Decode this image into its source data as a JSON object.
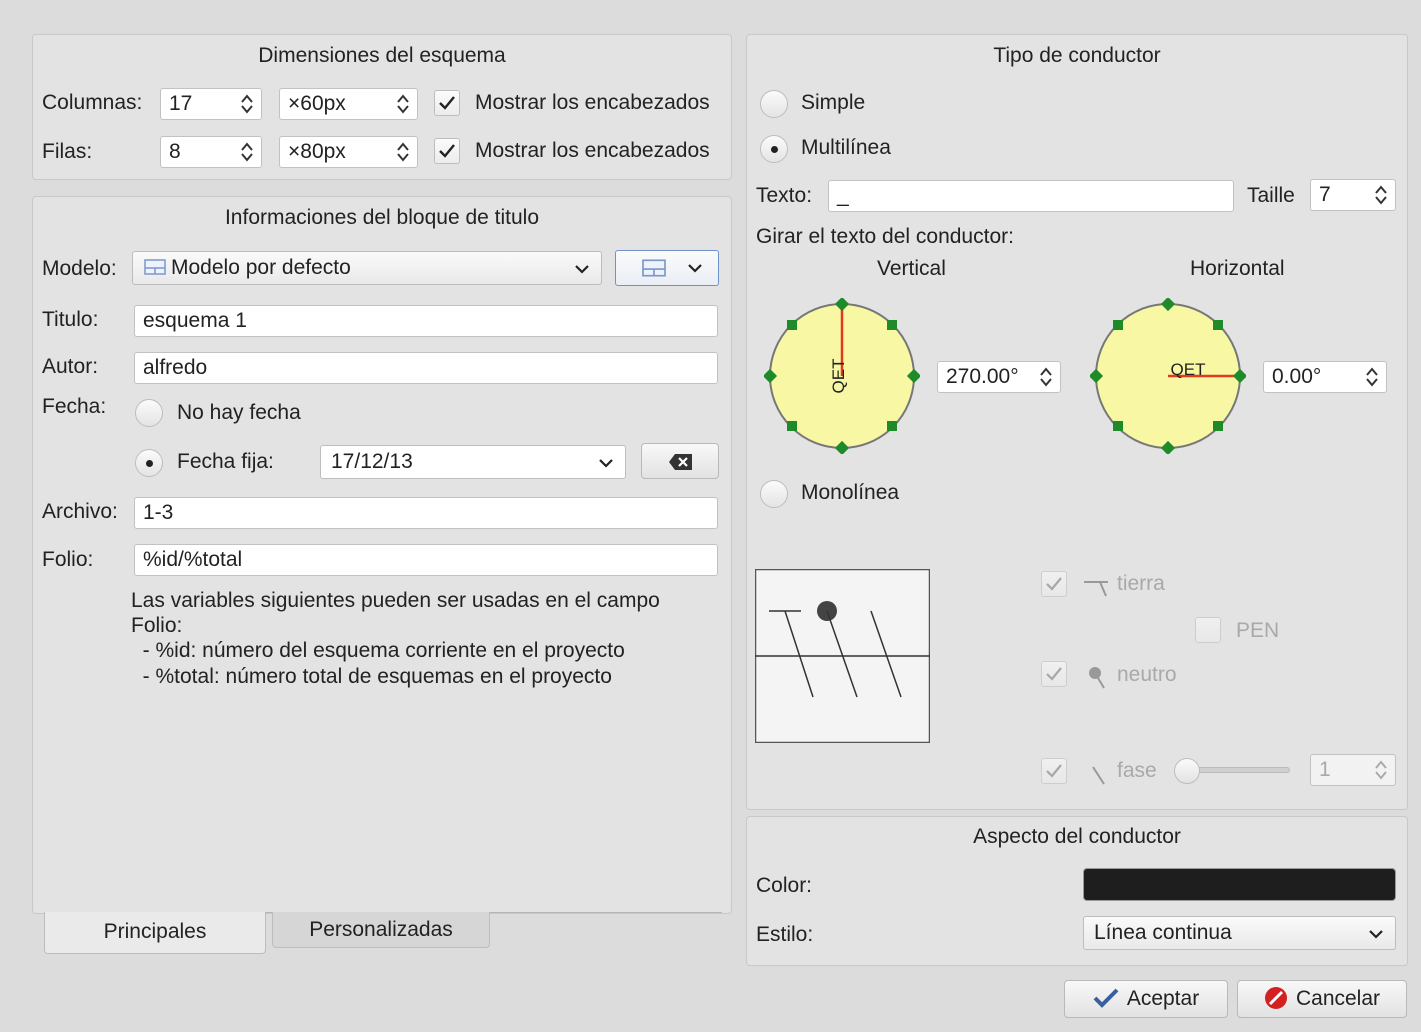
{
  "dimensions": {
    "title": "Dimensiones del esquema",
    "columns_label": "Columnas:",
    "columns_value": "17",
    "columns_size": "×60px",
    "rows_label": "Filas:",
    "rows_value": "8",
    "rows_size": "×80px",
    "show_headers_cols": "Mostrar los encabezados",
    "show_headers_rows": "Mostrar los encabezados"
  },
  "titleblock": {
    "title": "Informaciones del bloque de titulo",
    "model_label": "Modelo:",
    "model_value": "Modelo por defecto",
    "titulo_label": "Titulo:",
    "titulo_value": "esquema 1",
    "autor_label": "Autor:",
    "autor_value": "alfredo",
    "fecha_label": "Fecha:",
    "no_fecha_label": "No hay fecha",
    "fecha_fija_label": "Fecha fija:",
    "fecha_value": "17/12/13",
    "archivo_label": "Archivo:",
    "archivo_value": "1-3",
    "folio_label": "Folio:",
    "folio_value": "%id/%total",
    "help_line1": "Las variables siguientes pueden ser usadas en el campo",
    "help_line2": "Folio:",
    "help_line3": "  - %id: número del esquema corriente en el proyecto",
    "help_line4": "  - %total: número total de esquemas en el proyecto"
  },
  "tabs": [
    {
      "label": "Principales"
    },
    {
      "label": "Personalizadas"
    }
  ],
  "conductor": {
    "title": "Tipo de conductor",
    "simple_label": "Simple",
    "multiline_label": "Multilínea",
    "text_label": "Texto:",
    "text_value": "_",
    "size_label": "Taille",
    "size_value": "7",
    "rotate_label": "Girar el texto del conductor:",
    "vertical_label": "Vertical",
    "horizontal_label": "Horizontal",
    "dial_text": "QET",
    "vertical_angle": "270.00°",
    "horizontal_angle": "0.00°",
    "monoline_label": "Monolínea",
    "tierra_label": "tierra",
    "pen_label": "PEN",
    "neutro_label": "neutro",
    "fase_label": "fase",
    "fase_count": "1"
  },
  "appearance": {
    "title": "Aspecto del conductor",
    "color_label": "Color:",
    "color_value": "#1e1e1e",
    "style_label": "Estilo:",
    "style_value": "Línea continua"
  },
  "buttons": {
    "accept": "Aceptar",
    "cancel": "Cancelar"
  },
  "colors": {
    "dial_fill": "#f8f8a4",
    "dial_handle": "#1e8a2a",
    "dial_pointer": "#e53a1a",
    "cancel_red": "#d32020"
  }
}
